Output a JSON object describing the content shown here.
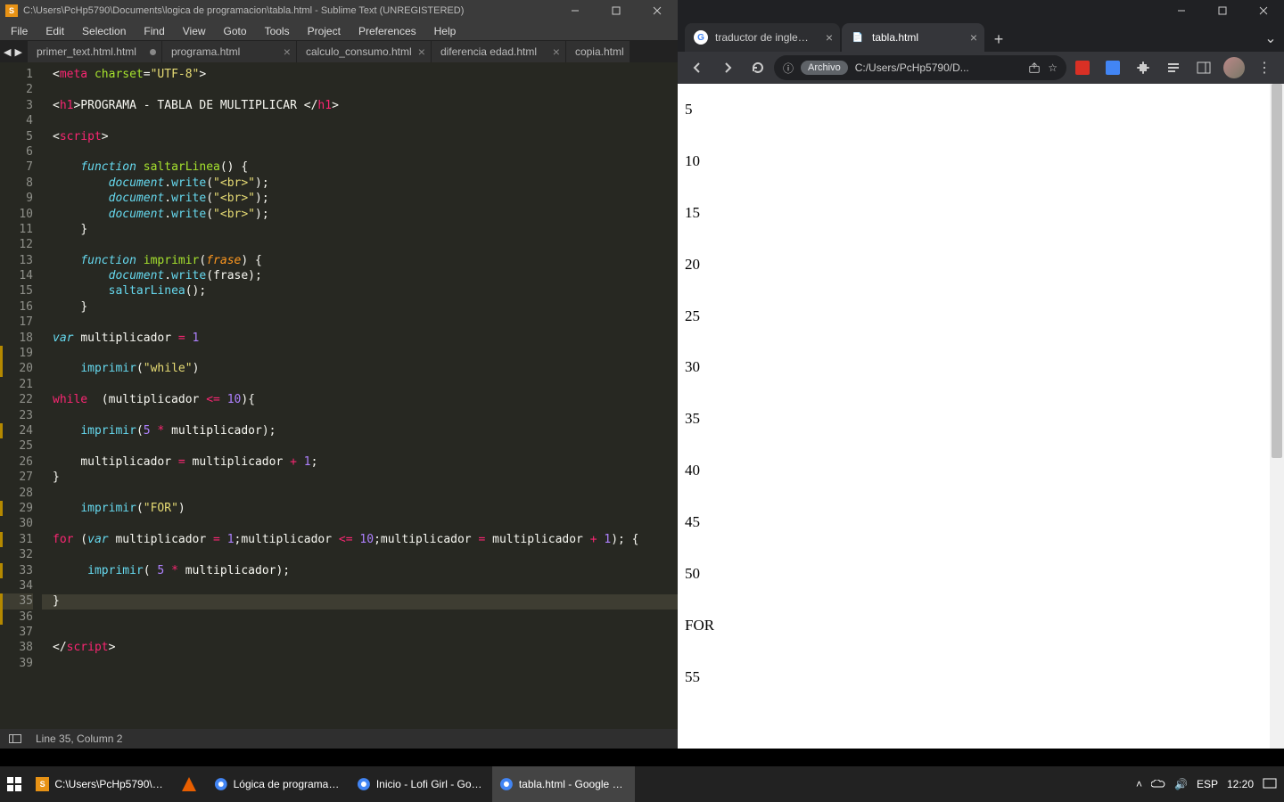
{
  "sublime": {
    "title": "C:\\Users\\PcHp5790\\Documents\\logica de programacion\\tabla.html - Sublime Text (UNREGISTERED)",
    "menubar": [
      "File",
      "Edit",
      "Selection",
      "Find",
      "View",
      "Goto",
      "Tools",
      "Project",
      "Preferences",
      "Help"
    ],
    "tabs": [
      {
        "label": "primer_text.html.html",
        "active": false,
        "dirty": true
      },
      {
        "label": "programa.html",
        "active": false,
        "dirty": false
      },
      {
        "label": "calculo_consumo.html",
        "active": false,
        "dirty": false
      },
      {
        "label": "diferencia edad.html",
        "active": false,
        "dirty": false
      },
      {
        "label": "copia.html",
        "active": false,
        "dirty": false,
        "partial": true
      }
    ],
    "status": "Line 35, Column 2",
    "active_line": 35,
    "modified_lines": [
      19,
      20,
      24,
      29,
      31,
      33,
      35,
      36
    ],
    "code_lines": 39
  },
  "chrome": {
    "tabs": [
      {
        "label": "traductor de ingles a esp",
        "favicon": "G",
        "active": false
      },
      {
        "label": "tabla.html",
        "favicon": "📄",
        "active": true
      }
    ],
    "omnibox": {
      "badge": "Archivo",
      "url": "C:/Users/PcHp5790/D..."
    },
    "page_rows": [
      "5",
      "10",
      "15",
      "20",
      "25",
      "30",
      "35",
      "40",
      "45",
      "50",
      "FOR",
      "55"
    ]
  },
  "taskbar": {
    "apps": [
      {
        "icon": "sublime",
        "label": "C:\\Users\\PcHp5790\\D...",
        "active": false
      },
      {
        "icon": "vlc",
        "label": "",
        "active": false,
        "narrow": true
      },
      {
        "icon": "chrome",
        "label": "Lógica de programaci...",
        "active": false
      },
      {
        "icon": "chrome",
        "label": "Inicio - Lofi Girl - Goo...",
        "active": false
      },
      {
        "icon": "chrome",
        "label": "tabla.html - Google C...",
        "active": true
      }
    ],
    "tray": {
      "lang": "ESP",
      "time": "12:20"
    }
  }
}
